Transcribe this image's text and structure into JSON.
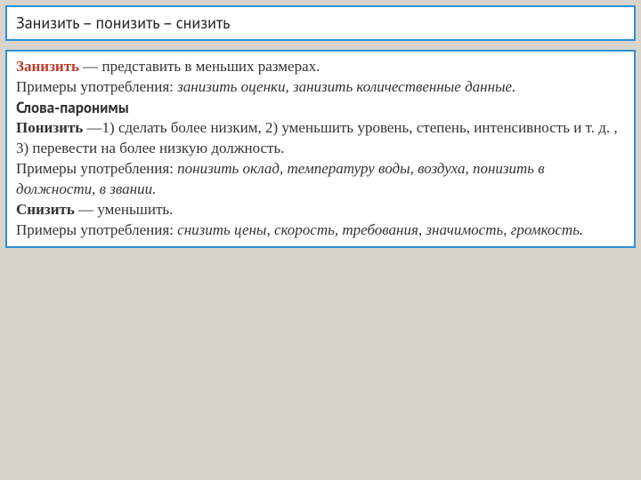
{
  "title": "Занизить – понизить – снизить",
  "entry1": {
    "term": "Занизить",
    "def": " — представить в меньших размерах.",
    "examples_label": "Примеры употребления: ",
    "examples": "занизить оценки, занизить количественные данные."
  },
  "paronyms_heading": "Слова-паронимы",
  "entry2": {
    "term": "Понизить",
    "def": " —1) сделать более низким, 2) уменьшить уровень, степень, интенсивность и т. д. , 3) перевести на более низкую должность.",
    "examples_label": "Примеры употребления: ",
    "examples": "понизить оклад, температуру воды, воздуха, понизить в должности, в звании."
  },
  "entry3": {
    "term": "Снизить",
    "def": " — уменьшить.",
    "examples_label": "Примеры употребления: ",
    "examples": "снизить цены, скорость, требования, значимость, громкость."
  }
}
